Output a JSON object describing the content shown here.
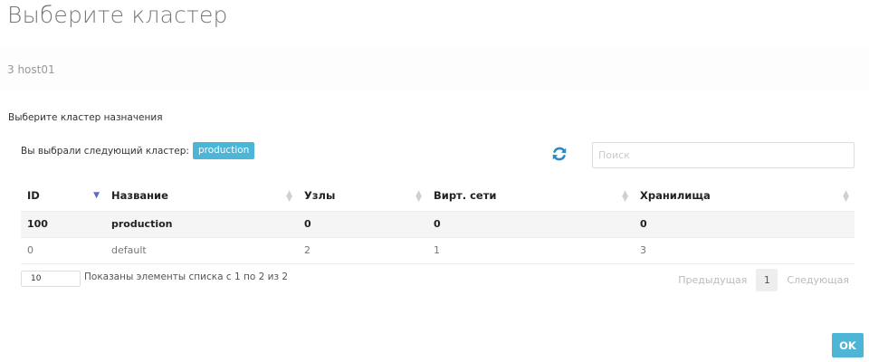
{
  "dialog": {
    "title": "Выберите кластер",
    "host_label": "3 host01",
    "section_label": "Выберите кластер назначения",
    "selected_prefix": "Вы выбрали следующий кластер:",
    "selected_cluster": "production"
  },
  "search": {
    "placeholder": "Поиск",
    "value": ""
  },
  "icons": {
    "refresh": "refresh-icon"
  },
  "colors": {
    "accent": "#4db6d7",
    "sort_active": "#5c6bc0",
    "refresh": "#2a8bc3"
  },
  "table": {
    "columns": [
      {
        "label": "ID",
        "sort": "desc"
      },
      {
        "label": "Название",
        "sort": "none"
      },
      {
        "label": "Узлы",
        "sort": "none"
      },
      {
        "label": "Вирт. сети",
        "sort": "none"
      },
      {
        "label": "Хранилища",
        "sort": "none"
      }
    ],
    "rows": [
      {
        "cells": [
          "100",
          "production",
          "0",
          "0",
          "0"
        ],
        "selected": true
      },
      {
        "cells": [
          "0",
          "default",
          "2",
          "1",
          "3"
        ],
        "selected": false
      }
    ]
  },
  "footer": {
    "page_length": "10",
    "info": "Показаны элементы списка с 1 по 2 из 2",
    "prev": "Предыдущая",
    "current_page": "1",
    "next": "Следующая"
  },
  "actions": {
    "ok_label": "OK"
  }
}
